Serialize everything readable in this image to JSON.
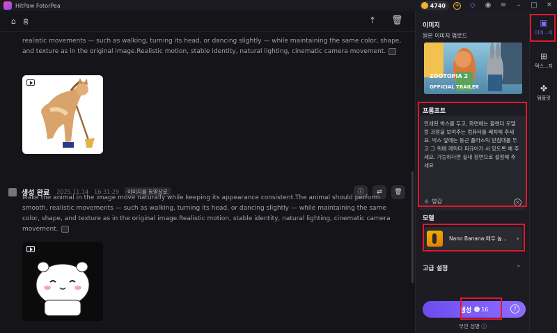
{
  "window": {
    "app_title": "HitPaw FotorPea",
    "credits": "4740"
  },
  "topbar": {
    "home_label": "홈"
  },
  "feed": {
    "prompt_text": "realistic movements — such as walking, turning its head, or dancing slightly — while maintaining the same color, shape, and texture as in the original image.Realistic motion, stable identity, natural lighting, cinematic camera movement.",
    "item": {
      "status": "생성 완료",
      "date": "2025.11.14",
      "time": "16:31:29",
      "tag": "이미지를 동영상로",
      "prompt_text": "Make the animal in the image move naturally while keeping its appearance consistent.The animal should perform smooth, realistic movements — such as walking, turning its head, or dancing slightly — while maintaining the same color, shape, and texture as in the original image.Realistic motion, stable identity, natural lighting, cinematic camera movement."
    }
  },
  "panel": {
    "image_title": "이미지",
    "upload_label": "원본 이미지 업로드",
    "upload_image_text": {
      "logo": "ZOOTOPIA 2",
      "trailer": "OFFICIAL TRAILER"
    },
    "prompt_title": "프롬프트",
    "prompt_value": "인쇄된 박스를 두고, 화면에는 블렌더 모델링 과정을 보여주는 컴퓨터를 배치해 주세요. 박스 앞에는 둥근 플라스틱 받침대를 두고 그 위에 캐릭터 피규어가 서 있도록 해 주세요. 가능하다면 실내 장면으로 설정해 주세요",
    "inspire_label": "영감",
    "model_title": "모델",
    "model_name": "Nano Banana:매우 높...",
    "advanced_label": "고급 설정",
    "generate_label": "생성",
    "generate_cost": "16",
    "disclaimer": "부인 성명"
  },
  "rail": {
    "items": [
      {
        "label": "이미...지",
        "icon": "image-icon"
      },
      {
        "label": "텍스...지",
        "icon": "text-image-icon"
      },
      {
        "label": "템플릿",
        "icon": "template-icon"
      }
    ]
  }
}
